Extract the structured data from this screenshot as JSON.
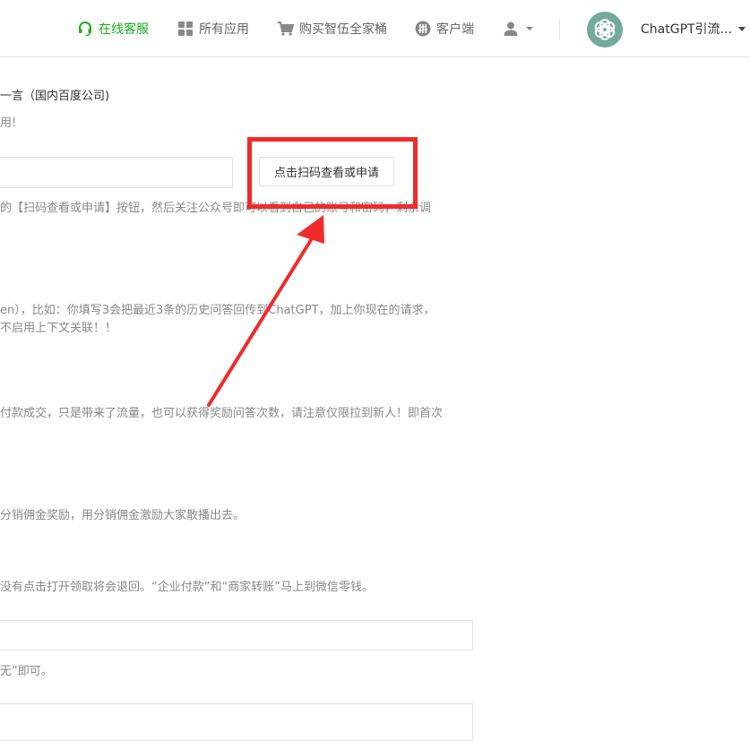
{
  "header": {
    "service_label": "在线客服",
    "apps_label": "所有应用",
    "buy_label": "购买智伍全家桶",
    "client_label": "客户端",
    "brand_name": "ChatGPT引流...",
    "icons": [
      "headset-icon",
      "grid-icon",
      "cart-icon",
      "sliders-icon",
      "user-icon",
      "openai-logo-icon"
    ]
  },
  "content": {
    "line1": "一言（国内百度公司)",
    "line2": "用!",
    "scan_button_label": "点击扫码查看或申请",
    "line3_a": "的【扫码查看或申请】按钮，然后关注公众号即可以看到自己的账号和密码，剩余调",
    "line4": "en），比如：你填写3会把最近3条的历史问答回传到ChatGPT，加上你现在的请求，",
    "line5": "不启用上下文关联！！",
    "line6": "付款成交，只是带来了流量，也可以获得奖励问答次数，请注意仅限拉到新人！即首次",
    "line7": "分销佣金奖励，用分销佣金激励大家散播出去。",
    "line8": "没有点击打开领取将会退回。“企业付款”和“商家转账”马上到微信零钱。",
    "line9": "无”即可。"
  },
  "colors": {
    "accent_green": "#1aad19",
    "highlight_red": "#f02b2b"
  }
}
